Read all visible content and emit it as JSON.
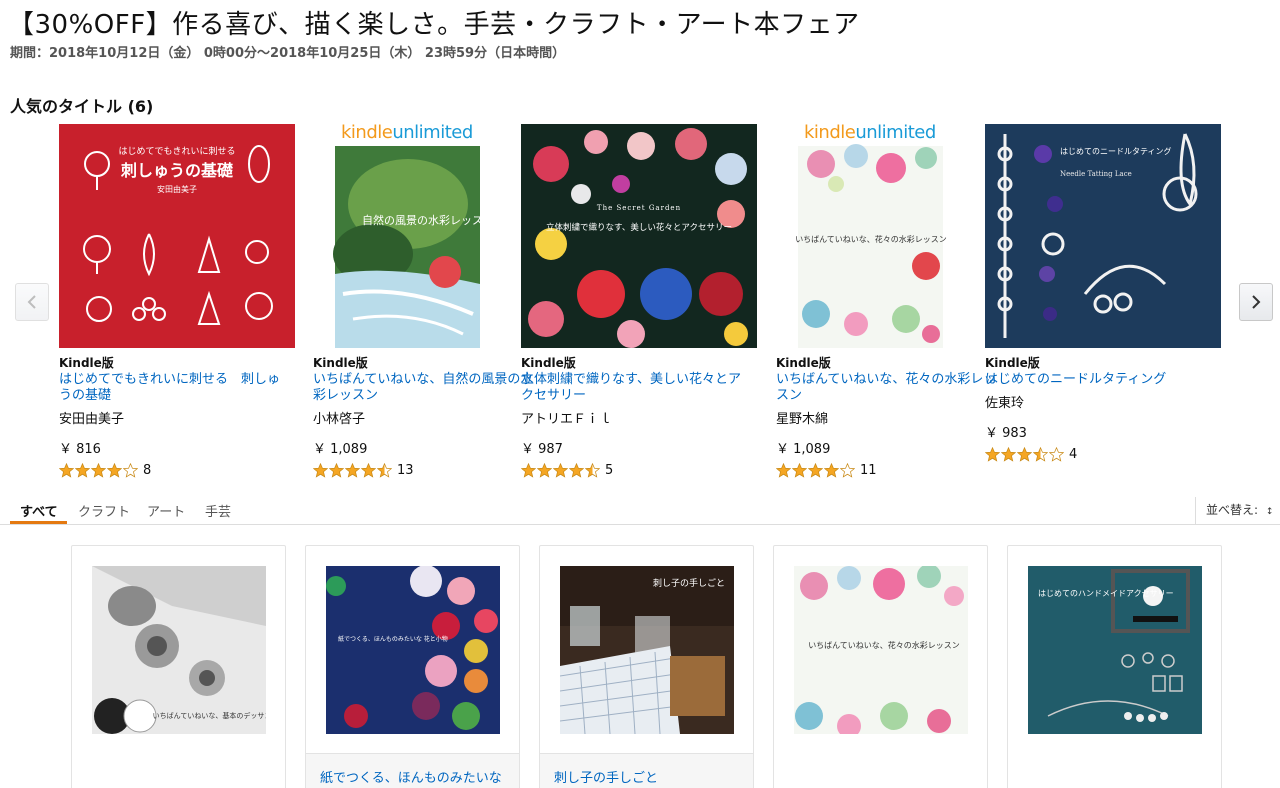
{
  "header": {
    "title": "【30%OFF】作る喜び、描く楽しさ。手芸・クラフト・アート本フェア",
    "period": "期間：2018年10月12日（金） 0時00分～2018年10月25日（木） 23時59分（日本時間）"
  },
  "carousel": {
    "section_title": "人気のタイトル (6)",
    "prev_icon": "chevron-left-icon",
    "next_icon": "chevron-right-icon",
    "kindle_unlimited": {
      "k": "kindle",
      "u": "unlimited"
    },
    "items": [
      {
        "format": "Kindle版",
        "title": "はじめてでもきれいに刺せる　刺しゅうの基礎",
        "author": "安田由美子",
        "price": "￥ 816",
        "rating": 4,
        "count": "8",
        "cover_color": "#c8202c",
        "cover_title": "刺しゅうの基礎",
        "cover_subtitle": "はじめてでもきれいに刺せる",
        "cover_author": "安田由美子",
        "kindle_unlimited": false
      },
      {
        "format": "Kindle版",
        "title": "いちばんていねいな、自然の風景の水彩レッスン",
        "author": "小林啓子",
        "price": "￥ 1,089",
        "rating": 4.5,
        "count": "13",
        "cover_color": "#3f7a3a",
        "cover_title": "自然の風景の水彩レッスン",
        "kindle_unlimited": true
      },
      {
        "format": "Kindle版",
        "title": "立体刺繍で織りなす、美しい花々とアクセサリー",
        "author": "アトリエＦｉｌ",
        "price": "￥ 987",
        "rating": 4.5,
        "count": "5",
        "cover_color": "#12271f",
        "cover_title": "立体刺繍で織りなす、美しい花々とアクセサリー",
        "cover_subtitle": "The Secret Garden",
        "kindle_unlimited": false
      },
      {
        "format": "Kindle版",
        "title": "いちばんていねいな、花々の水彩レッスン",
        "author": "星野木綿",
        "price": "￥ 1,089",
        "rating": 4,
        "count": "11",
        "cover_color": "#f4f7f2",
        "cover_title": "いちばんていねいな、花々の水彩レッスン",
        "kindle_unlimited": true
      },
      {
        "format": "Kindle版",
        "title": "はじめてのニードルタティング",
        "author": "佐東玲",
        "price": "￥ 983",
        "rating": 3.5,
        "count": "4",
        "cover_color": "#1d3b5c",
        "cover_title": "はじめてのニードルタティング",
        "cover_subtitle": "Needle Tatting Lace",
        "kindle_unlimited": false
      }
    ]
  },
  "tabs": {
    "items": [
      "すべて",
      "クラフト",
      "アート",
      "手芸"
    ],
    "active": "すべて",
    "sort_label": "並べ替え:"
  },
  "grid": {
    "items": [
      {
        "title": "",
        "cover_color": "#e9e9e9",
        "cover_title": "いちばんていねいな、基本のデッサン"
      },
      {
        "title": "紙でつくる、ほんものみたいな",
        "cover_color": "#1b2f6e",
        "cover_title": "紙でつくる、ほんものみたいな 花と小物"
      },
      {
        "title": "刺し子の手しごと",
        "cover_color": "#3a2a20",
        "cover_title": "刺し子の手しごと"
      },
      {
        "title": "",
        "cover_color": "#f4f7f2",
        "cover_title": "いちばんていねいな、花々の水彩レッスン"
      },
      {
        "title": "",
        "cover_color": "#215c6a",
        "cover_title": "はじめてのハンドメイドアクセサリー"
      }
    ]
  },
  "colors": {
    "link": "#0066c0",
    "star": "#f5a623",
    "tab_accent": "#e47911"
  }
}
